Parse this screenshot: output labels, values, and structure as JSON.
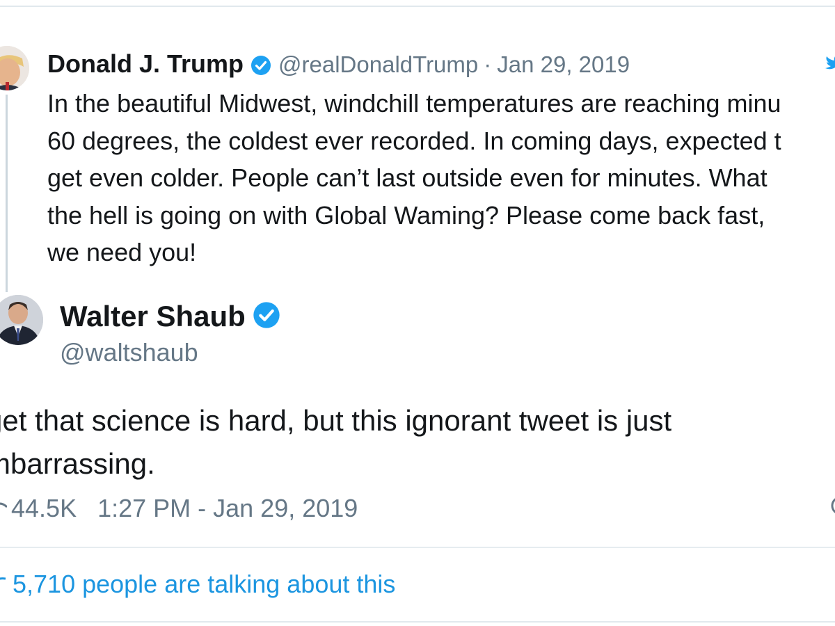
{
  "quoted_tweet": {
    "name": "Donald J. Trump",
    "handle": "@realDonaldTrump",
    "separator": "·",
    "date": "Jan 29, 2019",
    "text_lines": [
      "In the beautiful Midwest, windchill temperatures are reaching minu",
      "60 degrees, the coldest ever recorded. In coming days, expected t",
      "get even colder. People can’t last outside even for minutes. What",
      "the hell is going on with Global Waming? Please come back fast,",
      "we need you!"
    ]
  },
  "main_tweet": {
    "name": "Walter Shaub",
    "handle": "@waltshaub",
    "text_lines": [
      "get that science is hard, but this ignorant tweet is just",
      "mbarrassing."
    ],
    "likes": "44.5K",
    "timestamp": "1:27 PM - Jan 29, 2019"
  },
  "talking": "5,710 people are talking about this",
  "colors": {
    "verified_blue": "#1da1f2",
    "link_blue": "#1b95e0",
    "meta_gray": "#657786",
    "divider": "#e6ecf0"
  },
  "icons": [
    "verified-badge-icon",
    "twitter-bird-icon",
    "heart-icon",
    "info-icon",
    "comment-icon"
  ]
}
